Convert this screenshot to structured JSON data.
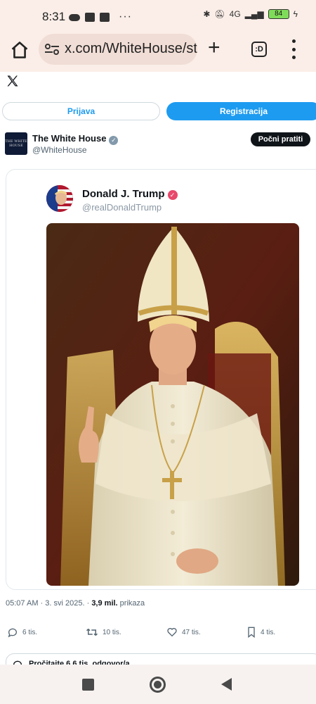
{
  "status_bar": {
    "time": "8:31",
    "overflow": "···",
    "network": "4G",
    "battery": "84"
  },
  "browser": {
    "url": "x.com/WhiteHouse/st",
    "tabs_label": ":D"
  },
  "page": {
    "login_label": "Prijava",
    "register_label": "Registracija"
  },
  "post": {
    "author_name": "The White House",
    "author_handle": "@WhiteHouse",
    "avatar_text": "THE WHITE HOUSE",
    "follow_label": "Počni pratiti",
    "quoted": {
      "name": "Donald J. Trump",
      "handle": "@realDonaldTrump"
    },
    "meta": {
      "time": "05:07 AM",
      "date": "3. svi 2025.",
      "views": "3,9 mil.",
      "views_label": "prikaza"
    },
    "actions": {
      "replies": "6 tis.",
      "reposts": "10 tis.",
      "likes": "47 tis.",
      "bookmarks": "4 tis."
    },
    "replies_bar": "Pročitajte 6,6 tis. odgovor/a"
  },
  "colors": {
    "accent": "#1d9bf0",
    "chrome": "#fbeee8",
    "verified_red": "#e8486b"
  }
}
